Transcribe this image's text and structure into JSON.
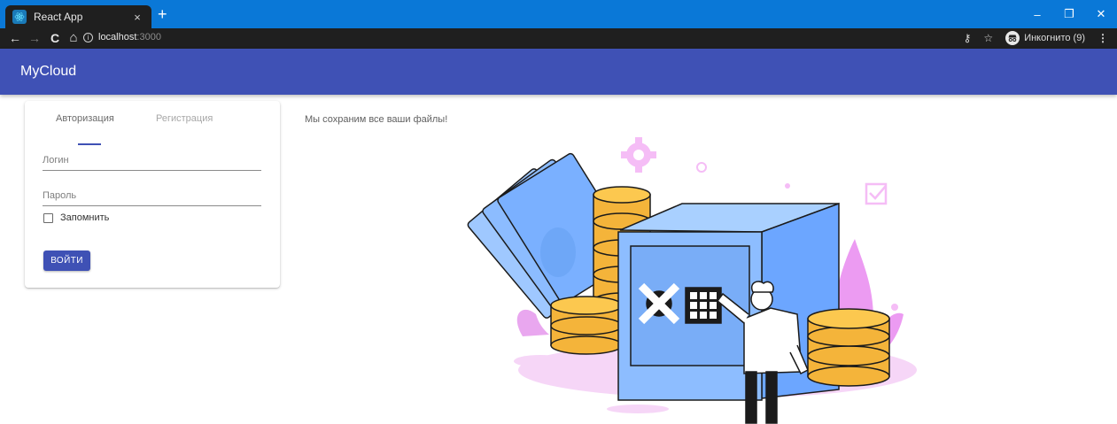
{
  "browser": {
    "tab_title": "React App",
    "tab_close": "×",
    "new_tab": "+",
    "window_controls": {
      "minimize": "–",
      "restore": "❐",
      "close": "✕"
    },
    "nav": {
      "back": "←",
      "forward": "→",
      "reload": "C",
      "home": "⌂"
    },
    "url_host": "localhost",
    "url_port": ":3000",
    "incognito_label": "Инкогнито (9)",
    "menu": "⋮",
    "key_icon": "⚷",
    "star_icon": "☆"
  },
  "app": {
    "title": "MyCloud",
    "accent_color": "#3f51b5"
  },
  "auth": {
    "tabs": [
      {
        "label": "Авторизация",
        "active": true
      },
      {
        "label": "Регистрация",
        "active": false
      }
    ],
    "login_placeholder": "Логин",
    "password_placeholder": "Пароль",
    "remember_label": "Запомнить",
    "remember_checked": false,
    "submit_label": "ВОЙТИ"
  },
  "promo": {
    "text": "Мы сохраним все ваши файлы!"
  }
}
